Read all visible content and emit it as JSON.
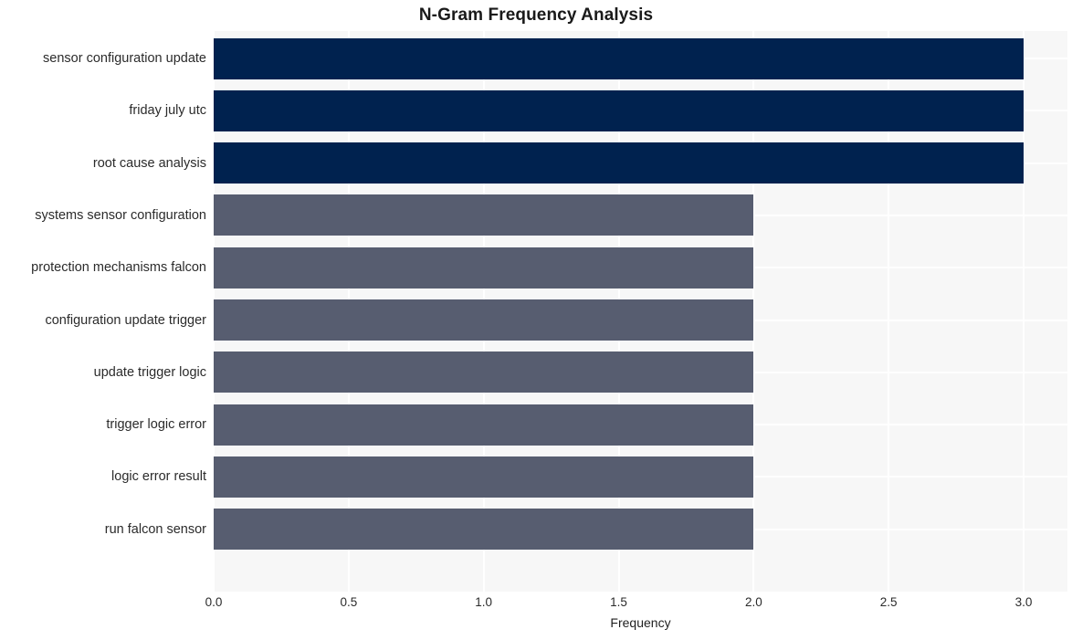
{
  "chart_data": {
    "type": "bar",
    "orientation": "horizontal",
    "title": "N-Gram Frequency Analysis",
    "xlabel": "Frequency",
    "ylabel": "",
    "categories": [
      "sensor configuration update",
      "friday july utc",
      "root cause analysis",
      "systems sensor configuration",
      "protection mechanisms falcon",
      "configuration update trigger",
      "update trigger logic",
      "trigger logic error",
      "logic error result",
      "run falcon sensor"
    ],
    "values": [
      3,
      3,
      3,
      2,
      2,
      2,
      2,
      2,
      2,
      2
    ],
    "bar_colors": [
      "#00224f",
      "#00224f",
      "#00224f",
      "#575d70",
      "#575d70",
      "#575d70",
      "#575d70",
      "#575d70",
      "#575d70",
      "#575d70"
    ],
    "xlim": [
      0.0,
      3.0
    ],
    "xticks": [
      0.0,
      0.5,
      1.0,
      1.5,
      2.0,
      2.5,
      3.0
    ],
    "xticklabels": [
      "0.0",
      "0.5",
      "1.0",
      "1.5",
      "2.0",
      "2.5",
      "3.0"
    ],
    "grid": true,
    "grid_color": "#ffffff",
    "plot_background": "#f7f7f7",
    "figure_background": "#ffffff",
    "legend": null,
    "colors": {
      "highlight": "#00224f",
      "secondary": "#575d70",
      "text": "#2b2b2b",
      "title": "#1a1a1a"
    }
  }
}
